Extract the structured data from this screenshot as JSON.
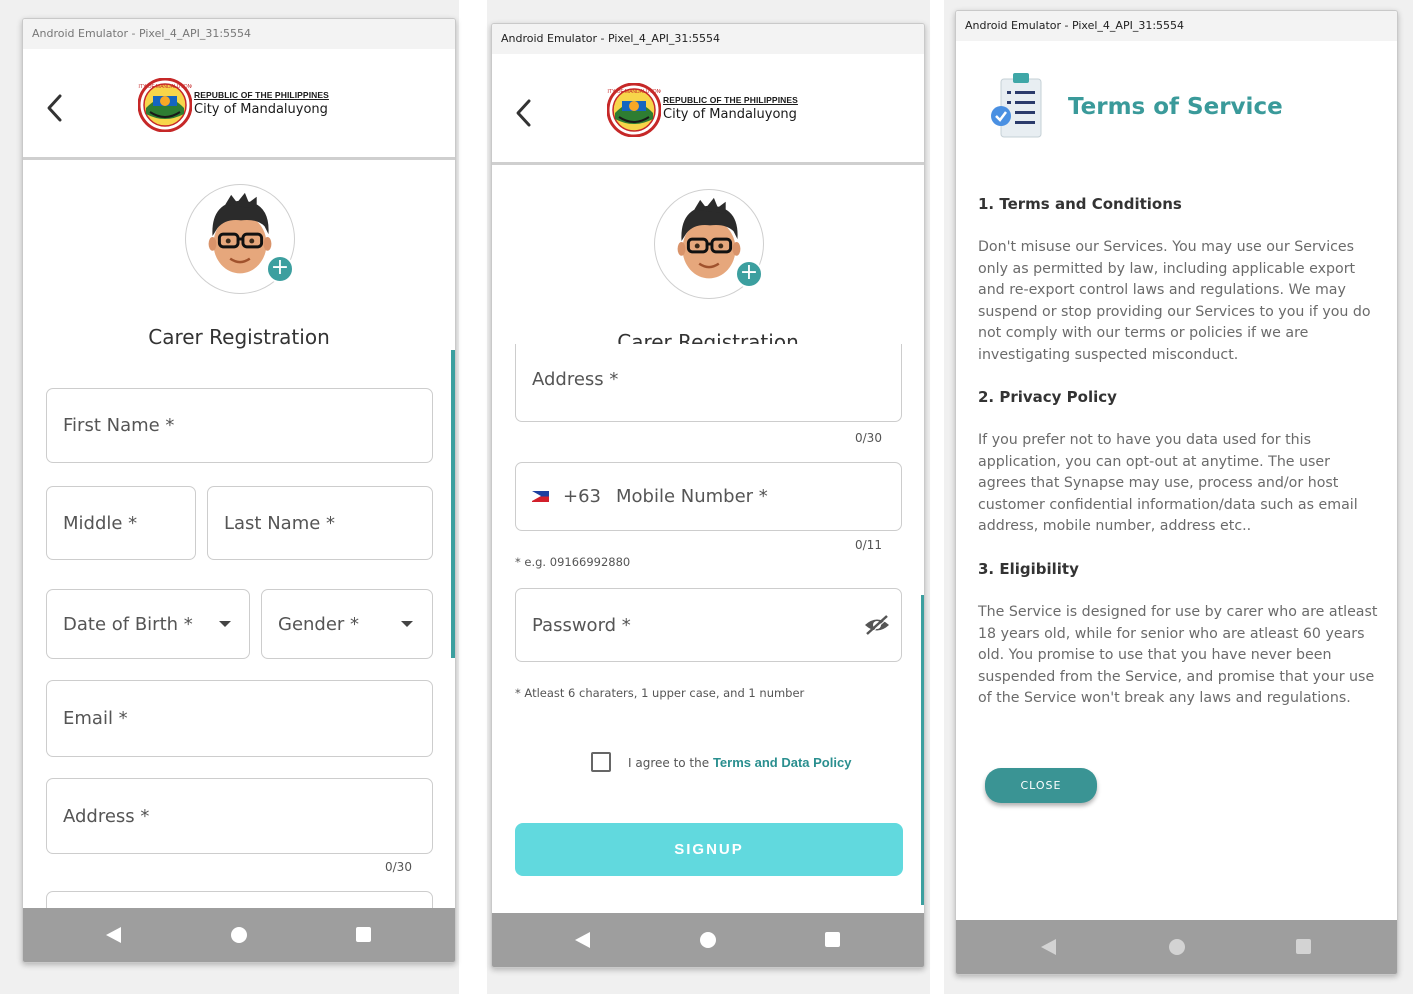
{
  "emulator_title": "Android Emulator - Pixel_4_API_31:5554",
  "logo": {
    "line1": "REPUBLIC OF THE PHILIPPINES",
    "line2": "City of Mandaluyong"
  },
  "registration": {
    "title": "Carer Registration",
    "first_name": "First Name *",
    "middle": "Middle *",
    "last_name": "Last Name *",
    "date_of_birth": "Date of Birth *",
    "gender": "Gender *",
    "email": "Email *",
    "address": "Address *",
    "address_counter": "0/30",
    "mobile_prefix": "+63",
    "mobile_number": "Mobile Number *",
    "mobile_counter": "0/11",
    "mobile_hint": "* e.g. 09166992880",
    "password": "Password *",
    "password_hint": "* Atleast 6 charaters, 1 upper case, and 1  number",
    "agree_text": "I agree to the ",
    "agree_link": "Terms and Data Policy",
    "signup_label": "SIGNUP"
  },
  "tos": {
    "title": "Terms of Service",
    "sections": [
      {
        "heading": "1. Terms and Conditions",
        "body": "Don't misuse our Services. You may use our Services only as permitted by law, including applicable export and re-export control laws and regulations. We may suspend or stop providing our Services to you if you do not comply with our terms or policies if we are investigating suspected misconduct."
      },
      {
        "heading": "2. Privacy Policy",
        "body": "If you prefer not to have you data used for this application, you can opt-out at anytime. The user agrees that Synapse may use, process and/or host customer confidential information/data such as email address, mobile number, address etc.."
      },
      {
        "heading": "3. Eligibility",
        "body": "The Service is designed for use by carer who are atleast 18 years old, while for senior who are atleast 60 years old. You promise to use that you have never been suspended from the Service, and promise that your use of the Service won't break any laws and regulations."
      }
    ],
    "close_label": "CLOSE"
  },
  "icons": {
    "back": "back-arrow-icon",
    "password_toggle": "eye-off-icon",
    "avatar_add": "plus-icon",
    "nav": [
      "nav-back-icon",
      "nav-home-icon",
      "nav-recents-icon"
    ]
  },
  "colors": {
    "accent": "#3c9f9f",
    "signup": "#61d9de",
    "close": "#3a9494",
    "navbar": "#9e9e9e"
  }
}
